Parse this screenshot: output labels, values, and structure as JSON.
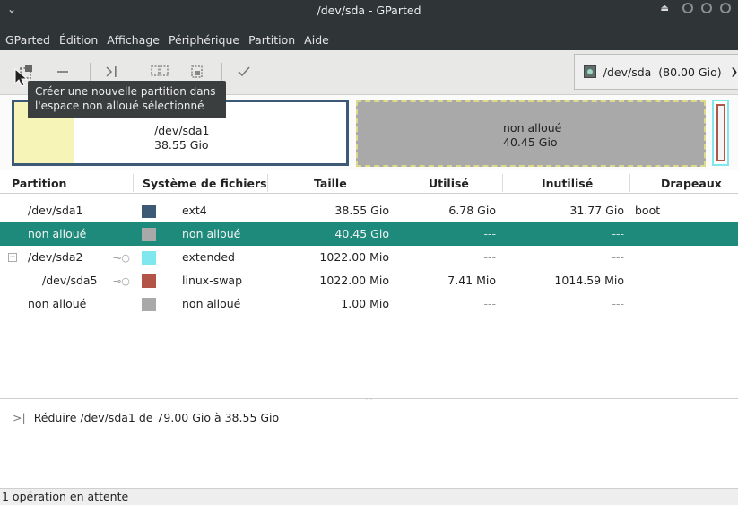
{
  "window": {
    "title": "/dev/sda - GParted"
  },
  "menubar": [
    "GParted",
    "Édition",
    "Affichage",
    "Périphérique",
    "Partition",
    "Aide"
  ],
  "toolbar": {
    "tooltip_line1": "Créer une nouvelle partition dans",
    "tooltip_line2": "l'espace non alloué sélectionné",
    "device": "/dev/sda  (80.00 Gio)"
  },
  "partbar": {
    "sda1_name": "/dev/sda1",
    "sda1_size": "38.55 Gio",
    "unalloc_name": "non alloué",
    "unalloc_size": "40.45 Gio"
  },
  "table": {
    "headers": [
      "Partition",
      "Système de fichiers",
      "Taille",
      "Utilisé",
      "Inutilisé",
      "Drapeaux"
    ],
    "rows": [
      {
        "partition": "/dev/sda1",
        "color": "#3c5a76",
        "fs": "ext4",
        "size": "38.55 Gio",
        "used": "6.78 Gio",
        "unused": "31.77 Gio",
        "flags": "boot"
      },
      {
        "partition": "non alloué",
        "color": "#a9a9a9",
        "fs": "non alloué",
        "size": "40.45 Gio",
        "used": "---",
        "unused": "---",
        "flags": ""
      },
      {
        "partition": "/dev/sda2",
        "color": "#7fe7ee",
        "fs": "extended",
        "size": "1022.00 Mio",
        "used": "---",
        "unused": "---",
        "flags": ""
      },
      {
        "partition": "/dev/sda5",
        "color": "#b25547",
        "fs": "linux-swap",
        "size": "1022.00 Mio",
        "used": "7.41 Mio",
        "unused": "1014.59 Mio",
        "flags": ""
      },
      {
        "partition": "non alloué",
        "color": "#a9a9a9",
        "fs": "non alloué",
        "size": "1.00 Mio",
        "used": "---",
        "unused": "---",
        "flags": ""
      }
    ]
  },
  "operations": [
    {
      "glyph": ">|",
      "text": "Réduire /dev/sda1 de 79.00 Gio à 38.55 Gio"
    }
  ],
  "status": "1 opération en attente",
  "colors": {
    "selection": "#1e8a7b",
    "header_bg": "#2f3436"
  }
}
